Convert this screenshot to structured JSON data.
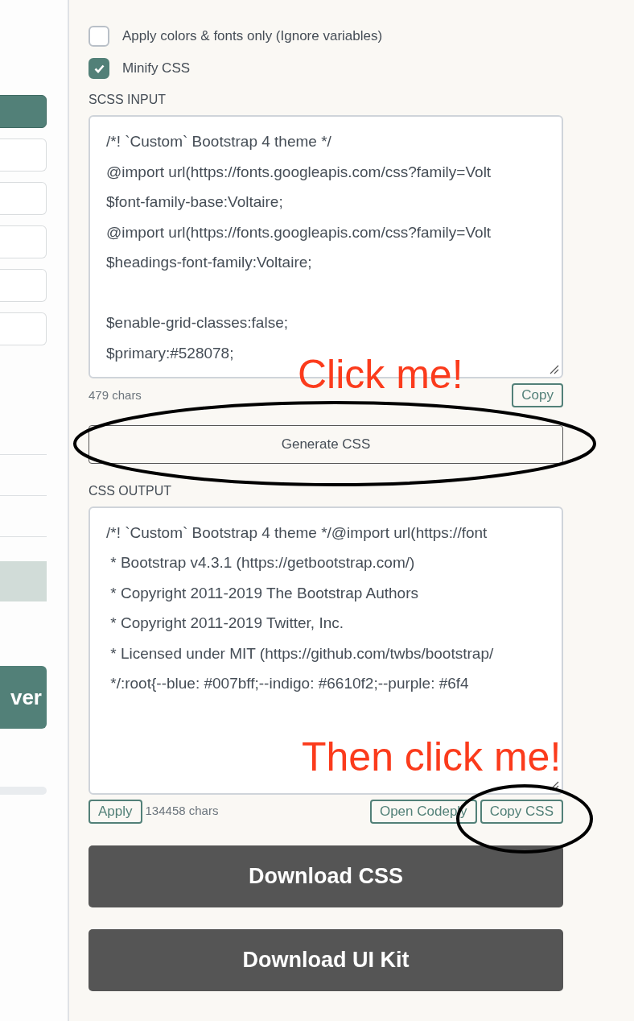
{
  "options": [
    {
      "label": "Apply colors & fonts only (Ignore variables)",
      "checked": false
    },
    {
      "label": "Minify CSS",
      "checked": true
    }
  ],
  "scss_input": {
    "label": "SCSS INPUT",
    "blocks": [
      [
        "/*! `Custom` Bootstrap 4 theme */",
        "@import url(https://fonts.googleapis.com/css?family=Volt",
        "$font-family-base:Voltaire;",
        "@import url(https://fonts.googleapis.com/css?family=Volt",
        "$headings-font-family:Voltaire;"
      ],
      [
        "$enable-grid-classes:false;",
        "$primary:#528078;"
      ]
    ],
    "count": "479 chars",
    "copy_button": "Copy"
  },
  "generate_button": "Generate CSS",
  "css_output": {
    "label": "CSS OUTPUT",
    "blocks": [
      [
        "/*! `Custom` Bootstrap 4 theme */@import url(https://font",
        " * Bootstrap v4.3.1 (https://getbootstrap.com/)",
        " * Copyright 2011-2019 The Bootstrap Authors",
        " * Copyright 2011-2019 Twitter, Inc.",
        " * Licensed under MIT (https://github.com/twbs/bootstrap/",
        " */:root{--blue: #007bff;--indigo: #6610f2;--purple: #6f4"
      ]
    ],
    "apply_button": "Apply",
    "count": "134458 chars",
    "codeply_button": "Open Codeply",
    "copy_button": "Copy CSS"
  },
  "download_buttons": [
    "Download CSS",
    "Download UI Kit"
  ],
  "sidebar": {
    "button_text": "ver"
  },
  "annotations": [
    {
      "text": "Click me!"
    },
    {
      "text": "Then click me!"
    }
  ]
}
